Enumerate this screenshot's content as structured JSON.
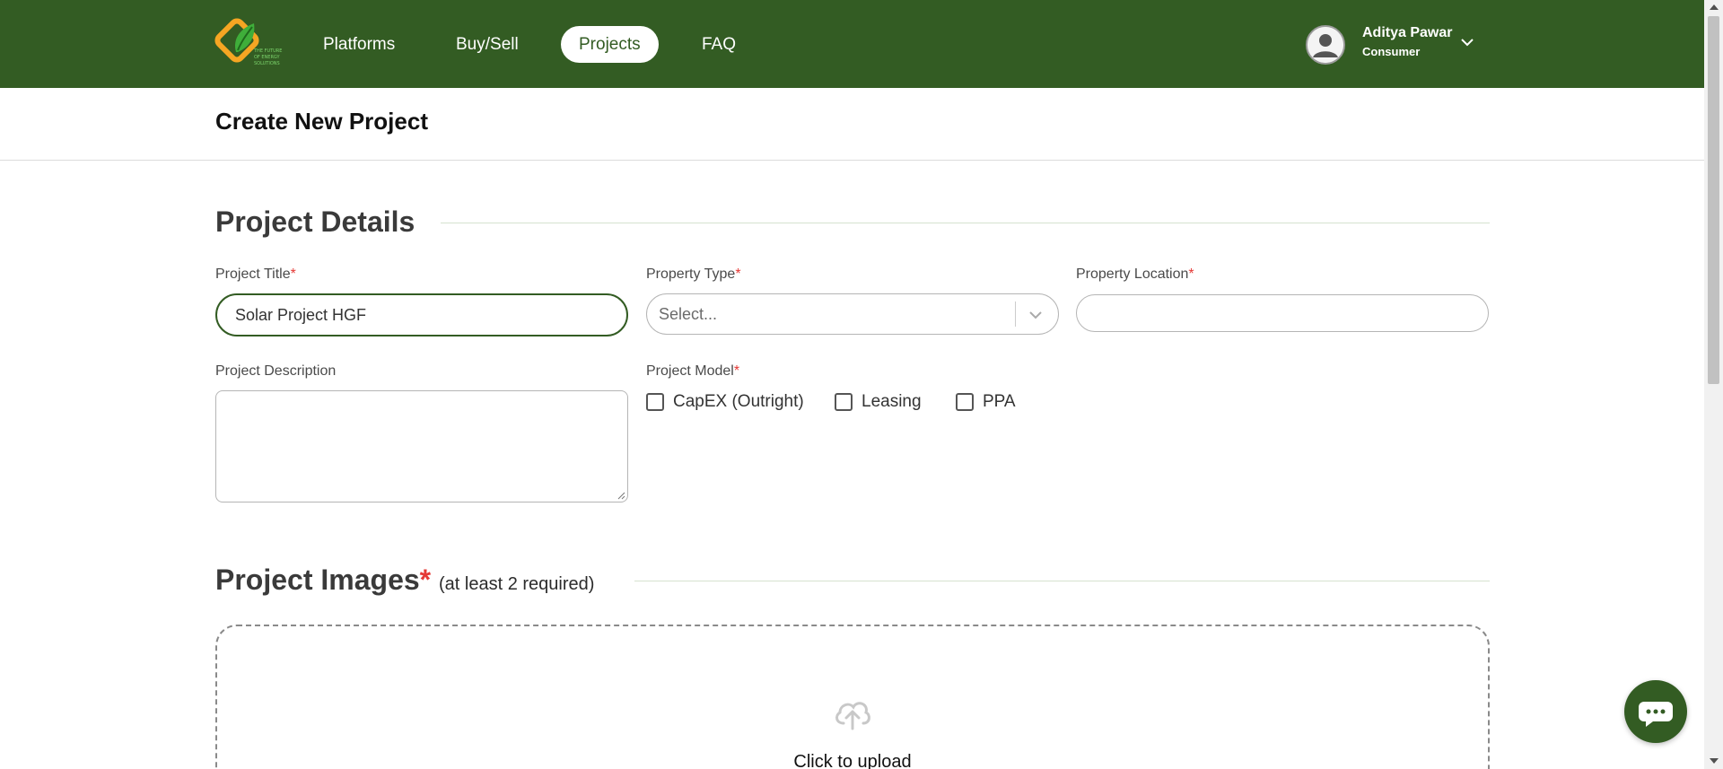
{
  "colors": {
    "brand_green": "#335c23",
    "required_star": "#e53935",
    "accent_logo": "#f5a623"
  },
  "nav": {
    "items": [
      {
        "label": "Platforms",
        "active": false
      },
      {
        "label": "Buy/Sell",
        "active": false
      },
      {
        "label": "Projects",
        "active": true
      },
      {
        "label": "FAQ",
        "active": false
      }
    ],
    "user": {
      "name": "Aditya Pawar",
      "role": "Consumer",
      "avatar_icon": "user-avatar-icon",
      "menu_icon": "chevron-down-icon"
    },
    "logo_icon": "leaf-logo-icon"
  },
  "page": {
    "title": "Create New Project"
  },
  "project_details": {
    "heading": "Project Details",
    "project_title": {
      "label": "Project Title",
      "required": "*",
      "value": "Solar Project HGF"
    },
    "property_type": {
      "label": "Property Type",
      "required": "*",
      "placeholder": "Select..."
    },
    "property_location": {
      "label": "Property Location",
      "required": "*",
      "value": ""
    },
    "project_description": {
      "label": "Project Description",
      "value": ""
    },
    "project_model": {
      "label": "Project Model",
      "required": "*",
      "options": [
        {
          "label": "CapEX (Outright)",
          "checked": false
        },
        {
          "label": "Leasing",
          "checked": false
        },
        {
          "label": "PPA",
          "checked": false
        }
      ]
    }
  },
  "project_images": {
    "heading": "Project Images",
    "required": "*",
    "subtitle": "(at least 2 required)",
    "upload_text": "Click to upload",
    "upload_icon": "cloud-upload-icon"
  },
  "chat": {
    "icon": "chat-bubble-icon"
  }
}
